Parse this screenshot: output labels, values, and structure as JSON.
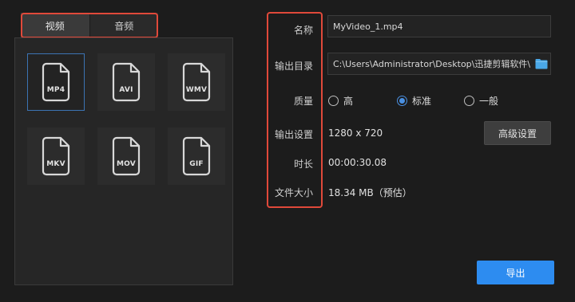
{
  "tabs": [
    {
      "label": "视频",
      "active": true
    },
    {
      "label": "音频",
      "active": false
    }
  ],
  "formats": [
    {
      "label": "MP4",
      "selected": true
    },
    {
      "label": "AVI",
      "selected": false
    },
    {
      "label": "WMV",
      "selected": false
    },
    {
      "label": "MKV",
      "selected": false
    },
    {
      "label": "MOV",
      "selected": false
    },
    {
      "label": "GIF",
      "selected": false
    }
  ],
  "settings": {
    "name_label": "名称",
    "name_value": "MyVideo_1.mp4",
    "dir_label": "输出目录",
    "dir_value": "C:\\Users\\Administrator\\Desktop\\迅捷剪辑软件\\",
    "dir_icon": "folder-icon",
    "quality_label": "质量",
    "quality_options": [
      {
        "label": "高",
        "checked": false
      },
      {
        "label": "标准",
        "checked": true
      },
      {
        "label": "一般",
        "checked": false
      }
    ],
    "output_label": "输出设置",
    "output_value": "1280 x 720",
    "advanced_label": "高级设置",
    "duration_label": "时长",
    "duration_value": "00:00:30.08",
    "size_label": "文件大小",
    "size_value": "18.34 MB（预估）"
  },
  "export_label": "导出",
  "colors": {
    "accent": "#2d8cf0",
    "highlight": "#e0493a",
    "selected_border": "#3c74b4",
    "folder": "#4aa8e8"
  }
}
